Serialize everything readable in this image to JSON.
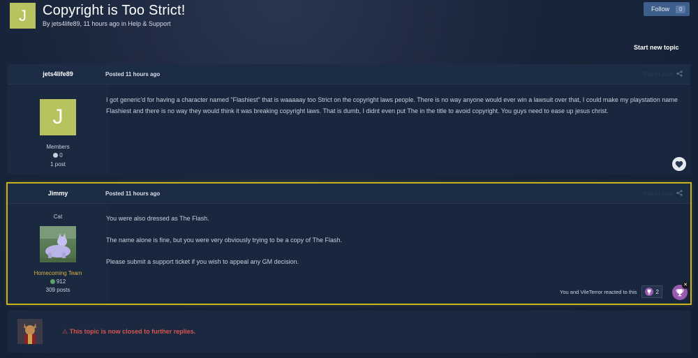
{
  "header": {
    "avatar_letter": "J",
    "title": "Copyright is Too Strict!",
    "meta": "By jets4life89, 11 hours ago in Help & Support",
    "follow_label": "Follow",
    "follow_count": "0",
    "start_new_topic": "Start new topic"
  },
  "posts": [
    {
      "author": "jets4life89",
      "posted": "Posted 11 hours ago",
      "report": "Report post",
      "avatar_letter": "J",
      "group": "Members",
      "reputation": "0",
      "post_count": "1 post",
      "body": "I got generic'd for having a character named \"Flashiest\" that is waaaaay too Strict on the copyright laws people. There is no way anyone would ever win a lawsuit over that, I could make my playstation name Flashiest and there is no way they would think it was breaking copyright laws. That is dumb, I didnt even put The in the title to avoid copyright. You guys need to ease up jesus christ."
    },
    {
      "author": "Jimmy",
      "posted": "Posted 11 hours ago",
      "report": "Report post",
      "title": "Cat",
      "group": "Homecoming Team",
      "reputation": "912",
      "post_count": "309 posts",
      "paragraphs": [
        "You were also dressed as The Flash.",
        "The name alone is fine, but you were very obviously trying to be a copy of The Flash.",
        "Please submit a support ticket if you wish to appeal any GM decision."
      ],
      "reactions_text": "You and VileTerror reacted to this",
      "reaction_count": "2"
    }
  ],
  "closed_notice": "This topic is now closed to further replies.",
  "colors": {
    "accent": "#3e5f8b",
    "highlight_border": "#c9b11f",
    "closed_text": "#d9534f",
    "team_gold": "#d9b344",
    "reaction_purple": "#9a5ab0"
  }
}
